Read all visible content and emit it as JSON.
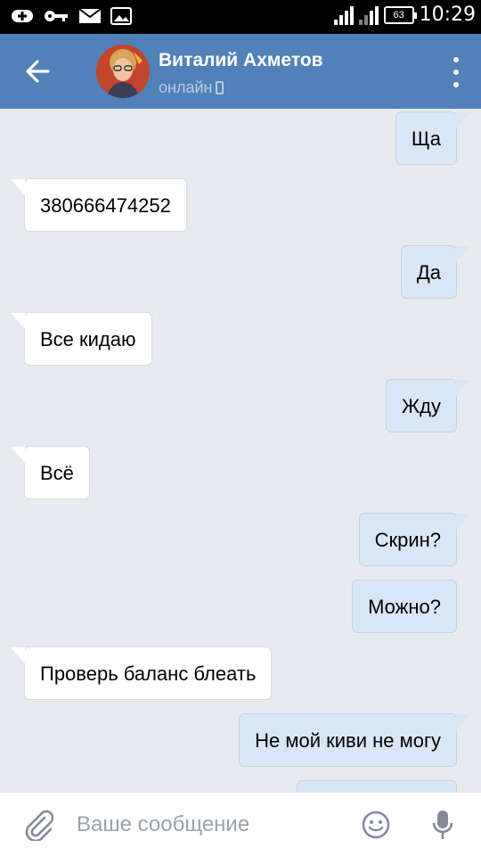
{
  "status_bar": {
    "time": "10:29",
    "battery": "63",
    "icons": [
      "download-icon",
      "key-icon",
      "mail-icon",
      "image-icon",
      "signal-icon",
      "battery-icon"
    ]
  },
  "header": {
    "contact_name": "Виталий Ахметов",
    "contact_status": "онлайн",
    "icons": [
      "back-arrow-icon",
      "avatar",
      "phone-icon",
      "more-vert-icon"
    ]
  },
  "messages": [
    {
      "direction": "out",
      "text": "Ща"
    },
    {
      "direction": "in",
      "text": "380666474252"
    },
    {
      "direction": "out",
      "text": "Да"
    },
    {
      "direction": "in",
      "text": "Все кидаю"
    },
    {
      "direction": "out",
      "text": "Жду"
    },
    {
      "direction": "in",
      "text": "Всё"
    },
    {
      "direction": "out",
      "text": "Скрин?"
    },
    {
      "direction": "out",
      "text": "Можно?"
    },
    {
      "direction": "in",
      "text": "Проверь баланс блеать"
    },
    {
      "direction": "out",
      "text": "Не мой киви не могу"
    },
    {
      "direction": "out",
      "text": ""
    }
  ],
  "input": {
    "placeholder": "Ваше сообщение",
    "value": "",
    "icons": [
      "paperclip-icon",
      "smile-icon",
      "microphone-icon"
    ]
  },
  "colors": {
    "header_bg": "#5181b8",
    "chat_bg": "#e7ebf0",
    "bubble_in": "#ffffff",
    "bubble_out": "#d9e6f5",
    "status_text": "#b8cde6"
  }
}
